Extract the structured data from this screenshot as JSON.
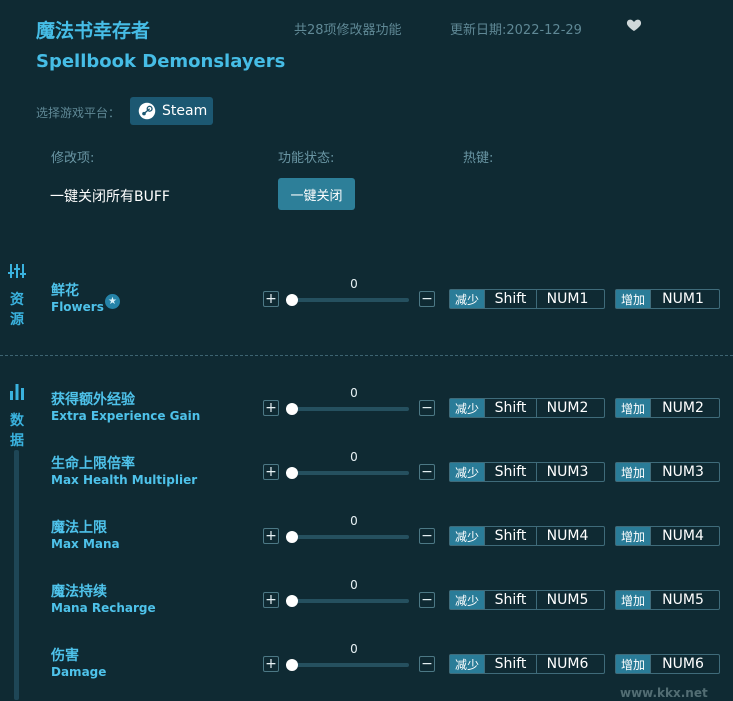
{
  "header": {
    "title_cn": "魔法书幸存者",
    "title_en": "Spellbook Demonslayers",
    "feature_count": "共28项修改器功能",
    "update_date": "更新日期:2022-12-29",
    "favorite_icon": "heart-icon"
  },
  "platform": {
    "label": "选择游戏平台：",
    "steam_label": "Steam"
  },
  "columns": {
    "mod": "修改项:",
    "status": "功能状态:",
    "hotkey": "热键:"
  },
  "buff": {
    "label": "一键关闭所有BUFF",
    "button": "一键关闭"
  },
  "sections": {
    "resources": {
      "line1": "资",
      "line2": "源"
    },
    "data": {
      "line1": "数",
      "line2": "据"
    }
  },
  "rows": [
    {
      "cn": "鲜花",
      "en": "Flowers",
      "value": "0",
      "dec_tag": "减少",
      "dec_mod": "Shift",
      "dec_key": "NUM1",
      "inc_tag": "增加",
      "inc_key": "NUM1"
    },
    {
      "cn": "获得额外经验",
      "en": "Extra Experience Gain",
      "value": "0",
      "dec_tag": "减少",
      "dec_mod": "Shift",
      "dec_key": "NUM2",
      "inc_tag": "增加",
      "inc_key": "NUM2"
    },
    {
      "cn": "生命上限倍率",
      "en": "Max Health Multiplier",
      "value": "0",
      "dec_tag": "减少",
      "dec_mod": "Shift",
      "dec_key": "NUM3",
      "inc_tag": "增加",
      "inc_key": "NUM3"
    },
    {
      "cn": "魔法上限",
      "en": "Max Mana",
      "value": "0",
      "dec_tag": "减少",
      "dec_mod": "Shift",
      "dec_key": "NUM4",
      "inc_tag": "增加",
      "inc_key": "NUM4"
    },
    {
      "cn": "魔法持续",
      "en": "Mana Recharge",
      "value": "0",
      "dec_tag": "减少",
      "dec_mod": "Shift",
      "dec_key": "NUM5",
      "inc_tag": "增加",
      "inc_key": "NUM5"
    },
    {
      "cn": "伤害",
      "en": "Damage",
      "value": "0",
      "dec_tag": "减少",
      "dec_mod": "Shift",
      "dec_key": "NUM6",
      "inc_tag": "增加",
      "inc_key": "NUM6"
    }
  ],
  "controls": {
    "plus": "+",
    "minus": "−",
    "star": "★"
  },
  "watermark": "www.kkx.net"
}
